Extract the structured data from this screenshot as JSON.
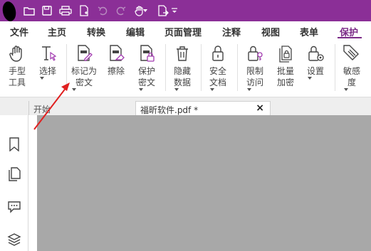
{
  "titlebar": {
    "icons": [
      "app-logo-icon",
      "open-folder-icon",
      "save-icon",
      "print-icon",
      "new-document-icon",
      "undo-icon",
      "redo-icon",
      "hand-tool-icon",
      "dropdown-caret-icon",
      "export-icon",
      "customize-toolbar-icon"
    ],
    "background": "#8b2f97"
  },
  "menu": {
    "items": [
      {
        "label": "文件"
      },
      {
        "label": "主页"
      },
      {
        "label": "转换"
      },
      {
        "label": "编辑"
      },
      {
        "label": "页面管理"
      },
      {
        "label": "注释"
      },
      {
        "label": "视图"
      },
      {
        "label": "表单"
      },
      {
        "label": "保护"
      }
    ],
    "active_color": "#7b2b87"
  },
  "ribbon": {
    "hand": {
      "l1": "手型",
      "l2": "工具"
    },
    "select": {
      "l1": "选择"
    },
    "mark_redact": {
      "l1": "标记为",
      "l2": "密文"
    },
    "erase": {
      "l1": "擦除"
    },
    "protect_redact": {
      "l1": "保护",
      "l2": "密文"
    },
    "hide_data": {
      "l1": "隐藏",
      "l2": "数据"
    },
    "secure_doc": {
      "l1": "安全",
      "l2": "文档"
    },
    "restrict_access": {
      "l1": "限制",
      "l2": "访问"
    },
    "batch_encrypt": {
      "l1": "批量",
      "l2": "加密"
    },
    "settings": {
      "l1": "设置"
    },
    "sensitivity": {
      "l1": "敏感",
      "l2": "度"
    }
  },
  "tabs": {
    "start": "开始",
    "file": "福昕软件.pdf *",
    "close": "×"
  },
  "sidebar": {
    "icons": [
      "bookmark-icon",
      "pages-icon",
      "comments-icon",
      "layers-icon"
    ]
  },
  "annotation": {
    "arrow_color": "#e02020"
  }
}
